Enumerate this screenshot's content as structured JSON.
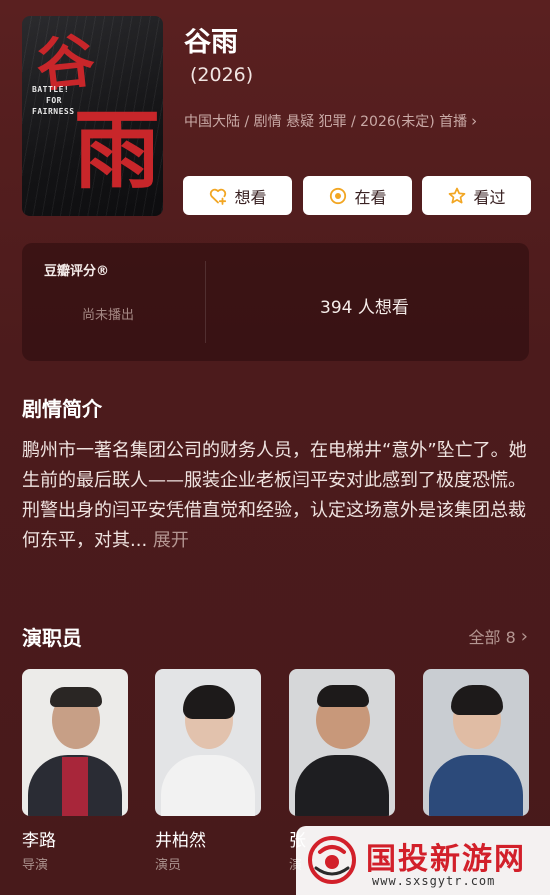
{
  "header": {
    "title": "谷雨",
    "year": "(2026)",
    "meta": "中国大陆 / 剧情 悬疑 犯罪 / 2026(未定) 首播",
    "poster": {
      "char_top": "谷",
      "char_main": "雨",
      "english_lines": [
        "BATTLE!",
        "FOR",
        "FAIRNESS"
      ]
    }
  },
  "actions": {
    "want": "想看",
    "watching": "在看",
    "watched": "看过"
  },
  "rating": {
    "label": "豆瓣评分®",
    "status": "尚未播出",
    "want_count": "394 人想看"
  },
  "synopsis": {
    "title": "剧情简介",
    "text": "鹏州市一著名集团公司的财务人员，在电梯井“意外”坠亡了。她生前的最后联人——服装企业老板闫平安对此感到了极度恐慌。刑警出身的闫平安凭借直觉和经验，认定这场意外是该集团总裁何东平，对其...",
    "more": "展开"
  },
  "cast": {
    "title": "演职员",
    "all_label": "全部 8",
    "members": [
      {
        "name": "李路",
        "role": "导演"
      },
      {
        "name": "井柏然",
        "role": "演员"
      },
      {
        "name": "张",
        "role": "演"
      },
      {
        "name": "",
        "role": ""
      }
    ]
  },
  "watermark": {
    "text": "国投新游网",
    "url": "www.sxsgytr.com"
  },
  "colors": {
    "background": "#4a1a1b",
    "accent": "#f2a623",
    "watermark_red": "#d2202a"
  }
}
